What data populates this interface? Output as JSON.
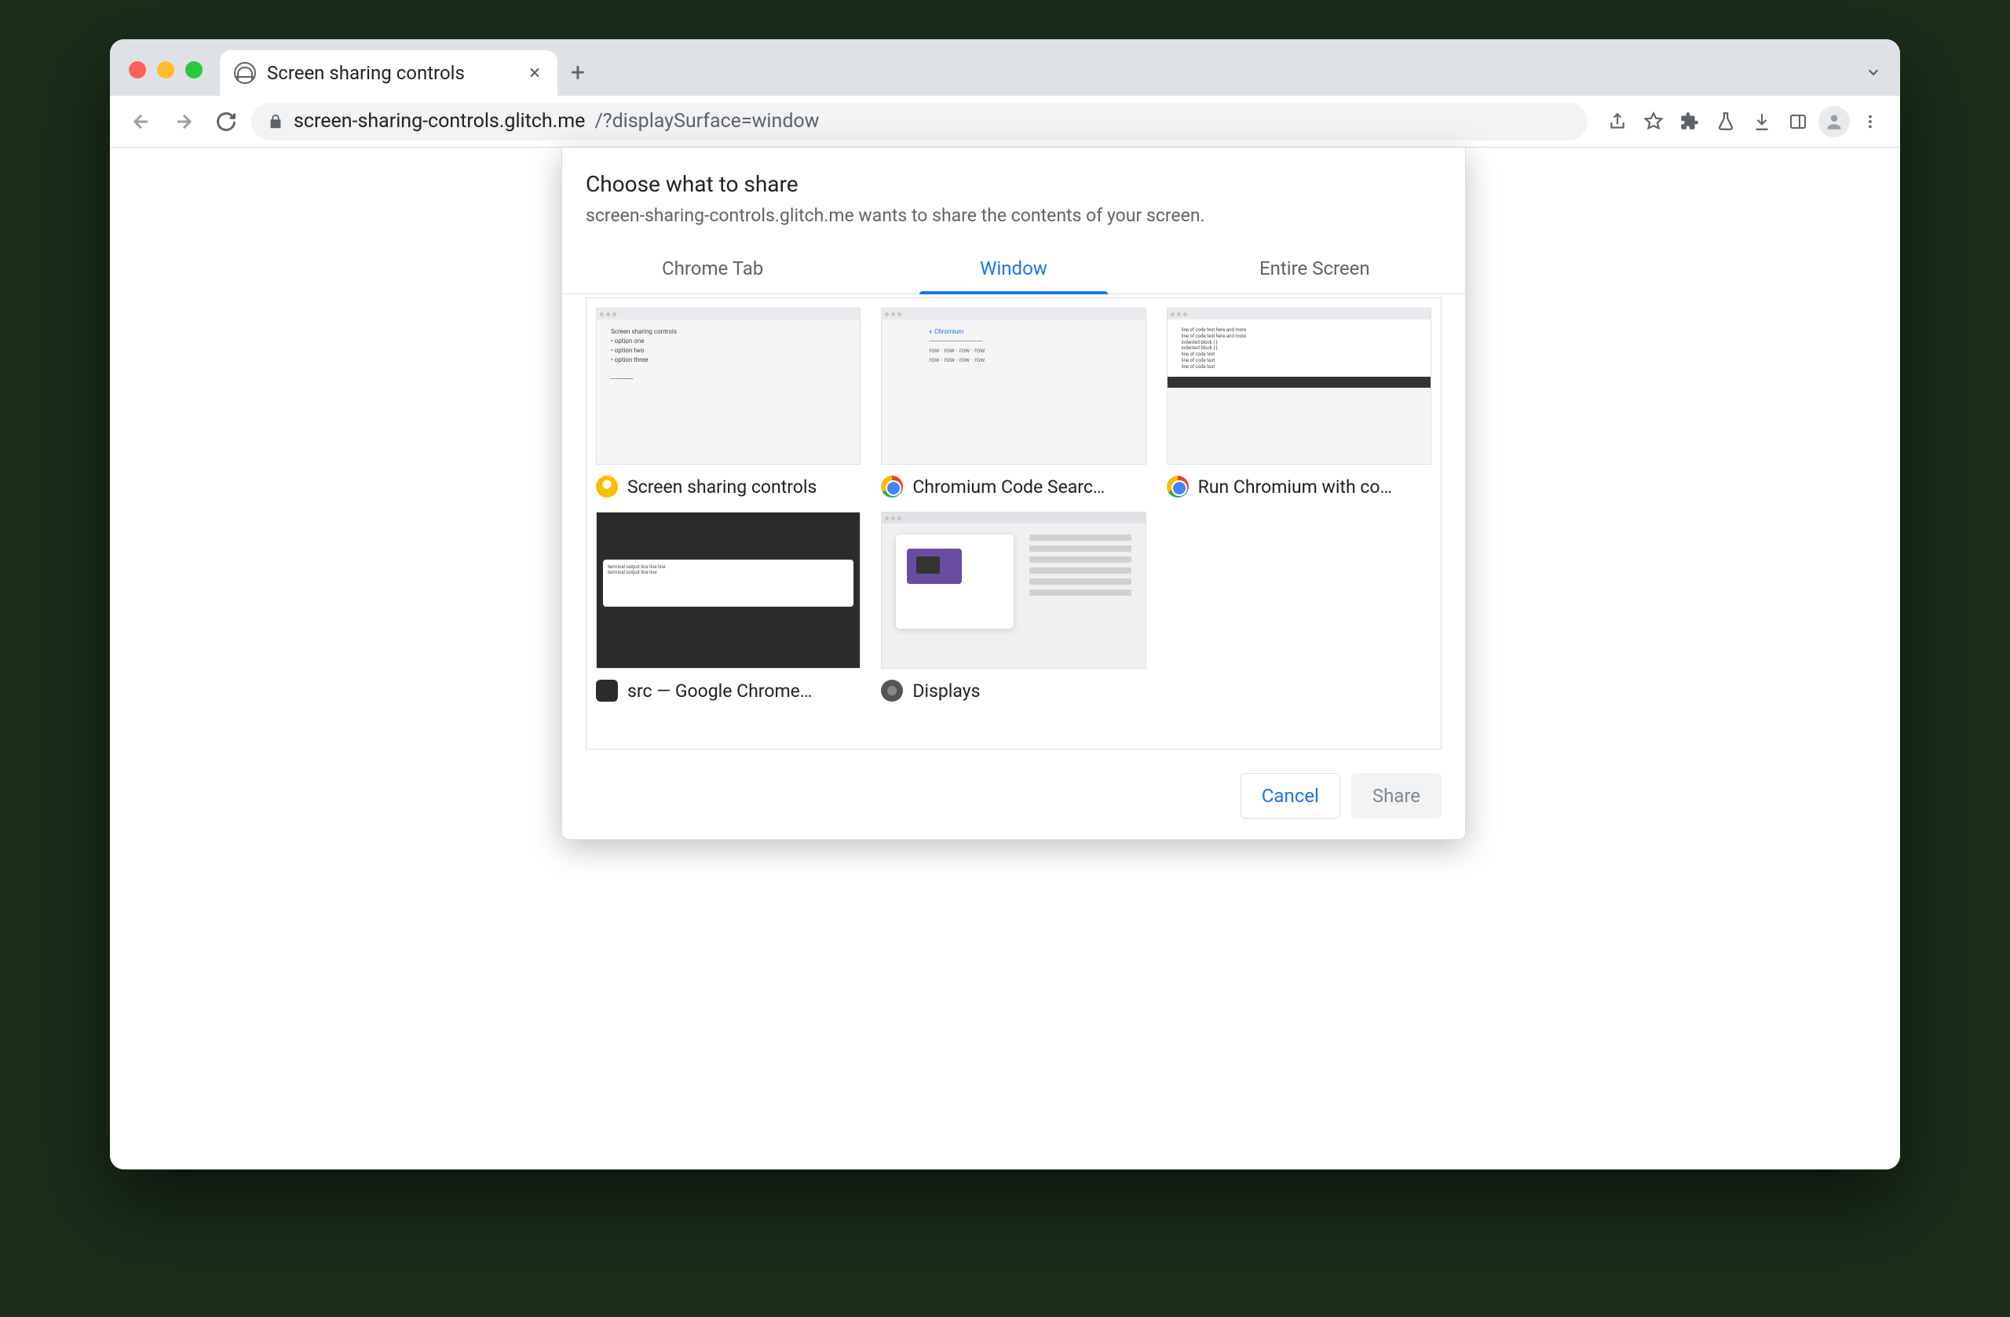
{
  "browser": {
    "tab_title": "Screen sharing controls",
    "url_host": "screen-sharing-controls.glitch.me",
    "url_path": "/?displaySurface=window"
  },
  "modal": {
    "title": "Choose what to share",
    "subtitle": "screen-sharing-controls.glitch.me wants to share the contents of your screen.",
    "tabs": {
      "chrome_tab": "Chrome Tab",
      "window": "Window",
      "entire_screen": "Entire Screen"
    },
    "items": [
      {
        "label": "Screen sharing controls",
        "icon": "canary"
      },
      {
        "label": "Chromium Code Searc…",
        "icon": "chrome"
      },
      {
        "label": "Run Chromium with co…",
        "icon": "chrome"
      },
      {
        "label": "src — Google Chrome…",
        "icon": "term"
      },
      {
        "label": "Displays",
        "icon": "sys"
      }
    ],
    "buttons": {
      "cancel": "Cancel",
      "share": "Share"
    }
  }
}
